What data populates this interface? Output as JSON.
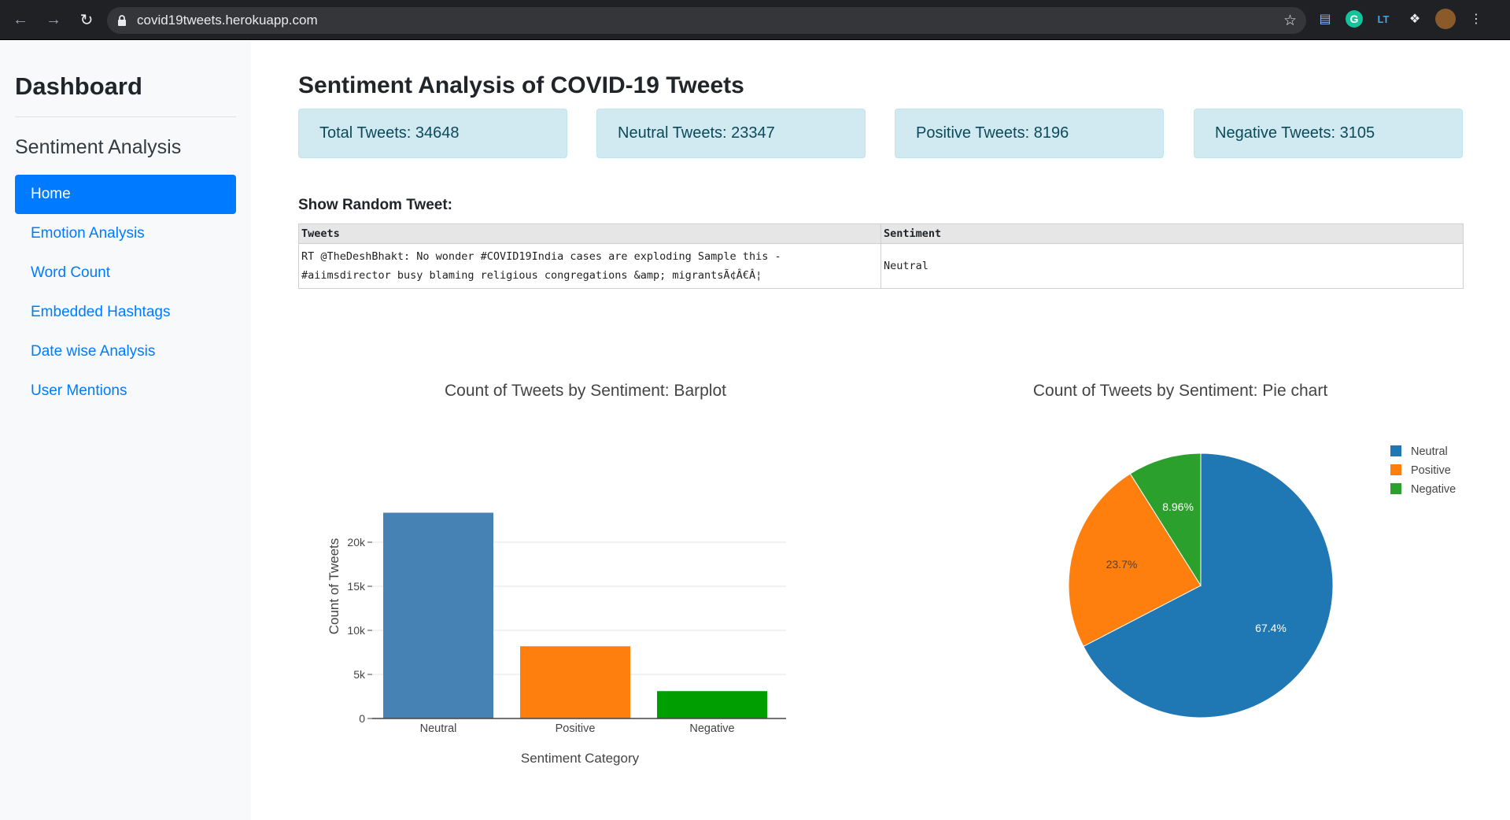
{
  "browser": {
    "url": "covid19tweets.herokuapp.com"
  },
  "sidebar": {
    "brand": "Dashboard",
    "subtitle": "Sentiment Analysis",
    "items": [
      {
        "label": "Home",
        "active": true
      },
      {
        "label": "Emotion Analysis",
        "active": false
      },
      {
        "label": "Word Count",
        "active": false
      },
      {
        "label": "Embedded Hashtags",
        "active": false
      },
      {
        "label": "Date wise Analysis",
        "active": false
      },
      {
        "label": "User Mentions",
        "active": false
      }
    ]
  },
  "main": {
    "title": "Sentiment Analysis of COVID-19 Tweets",
    "stats": [
      {
        "label": "Total Tweets: 34648"
      },
      {
        "label": "Neutral Tweets: 23347"
      },
      {
        "label": "Positive Tweets: 8196"
      },
      {
        "label": "Negative Tweets: 3105"
      }
    ],
    "random_tweet": {
      "heading": "Show Random Tweet:",
      "columns": [
        "Tweets",
        "Sentiment"
      ],
      "row": {
        "tweet_line1": "RT @TheDeshBhakt: No wonder #COVID19India cases are exploding Sample this -",
        "tweet_line2": "#aiimsdirector busy blaming religious congregations &amp; migrantsÃ¢Â€Â¦",
        "sentiment": "Neutral"
      }
    }
  },
  "colors": {
    "bar_neutral": "#4682b4",
    "bar_positive": "#ff7f0e",
    "bar_negative": "#009e00",
    "pie_neutral": "#1f77b4",
    "pie_positive": "#ff7f0e",
    "pie_negative": "#2ca02c"
  },
  "chart_data": [
    {
      "type": "bar",
      "title": "Count of Tweets by Sentiment: Barplot",
      "xlabel": "Sentiment Category",
      "ylabel": "Count of Tweets",
      "categories": [
        "Neutral",
        "Positive",
        "Negative"
      ],
      "values": [
        23347,
        8196,
        3105
      ],
      "ylim": [
        0,
        24000
      ],
      "yticks": [
        0,
        5000,
        10000,
        15000,
        20000
      ],
      "ytick_labels": [
        "0",
        "5k",
        "10k",
        "15k",
        "20k"
      ],
      "grid": true
    },
    {
      "type": "pie",
      "title": "Count of Tweets by Sentiment: Pie chart",
      "labels": [
        "Neutral",
        "Positive",
        "Negative"
      ],
      "values": [
        23347,
        8196,
        3105
      ],
      "slice_labels": [
        "67.4%",
        "23.7%",
        "8.96%"
      ],
      "legend_position": "top-right"
    }
  ]
}
